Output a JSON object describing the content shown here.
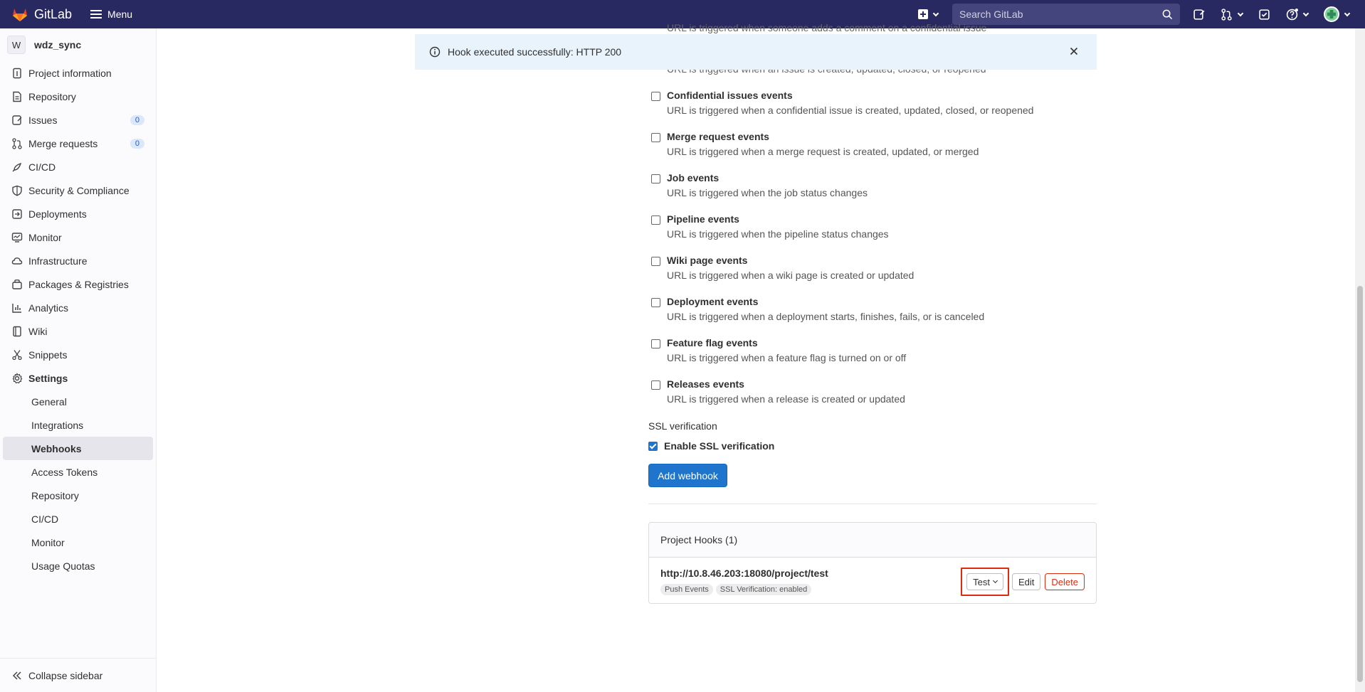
{
  "topbar": {
    "brand": "GitLab",
    "menu_label": "Menu",
    "search_placeholder": "Search GitLab"
  },
  "sidebar": {
    "project_initial": "W",
    "project_name": "wdz_sync",
    "items": [
      {
        "label": "Project information",
        "icon": "info-icon"
      },
      {
        "label": "Repository",
        "icon": "doc-icon"
      },
      {
        "label": "Issues",
        "icon": "issues-icon",
        "badge": "0"
      },
      {
        "label": "Merge requests",
        "icon": "merge-icon",
        "badge": "0"
      },
      {
        "label": "CI/CD",
        "icon": "rocket-icon"
      },
      {
        "label": "Security & Compliance",
        "icon": "shield-icon"
      },
      {
        "label": "Deployments",
        "icon": "deploy-icon"
      },
      {
        "label": "Monitor",
        "icon": "monitor-icon"
      },
      {
        "label": "Infrastructure",
        "icon": "cloud-icon"
      },
      {
        "label": "Packages & Registries",
        "icon": "package-icon"
      },
      {
        "label": "Analytics",
        "icon": "chart-icon"
      },
      {
        "label": "Wiki",
        "icon": "book-icon"
      },
      {
        "label": "Snippets",
        "icon": "scissors-icon"
      },
      {
        "label": "Settings",
        "icon": "gear-icon"
      }
    ],
    "settings_sub": [
      "General",
      "Integrations",
      "Webhooks",
      "Access Tokens",
      "Repository",
      "CI/CD",
      "Monitor",
      "Usage Quotas"
    ],
    "collapse_label": "Collapse sidebar"
  },
  "flash": {
    "message": "Hook executed successfully: HTTP 200"
  },
  "partial_lines": {
    "top1": "URL is triggered when someone adds a comment on a confidential issue",
    "top2": "URL is triggered when an issue is created, updated, closed, or reopened"
  },
  "events": [
    {
      "title": "Confidential issues events",
      "desc": "URL is triggered when a confidential issue is created, updated, closed, or reopened"
    },
    {
      "title": "Merge request events",
      "desc": "URL is triggered when a merge request is created, updated, or merged"
    },
    {
      "title": "Job events",
      "desc": "URL is triggered when the job status changes"
    },
    {
      "title": "Pipeline events",
      "desc": "URL is triggered when the pipeline status changes"
    },
    {
      "title": "Wiki page events",
      "desc": "URL is triggered when a wiki page is created or updated"
    },
    {
      "title": "Deployment events",
      "desc": "URL is triggered when a deployment starts, finishes, fails, or is canceled"
    },
    {
      "title": "Feature flag events",
      "desc": "URL is triggered when a feature flag is turned on or off"
    },
    {
      "title": "Releases events",
      "desc": "URL is triggered when a release is created or updated"
    }
  ],
  "ssl": {
    "section_label": "SSL verification",
    "checkbox_label": "Enable SSL verification",
    "checked": true
  },
  "add_button": "Add webhook",
  "hooks": {
    "header": "Project Hooks (1)",
    "url": "http://10.8.46.203:18080/project/test",
    "tags": [
      "Push Events",
      "SSL Verification: enabled"
    ],
    "test_label": "Test",
    "edit_label": "Edit",
    "delete_label": "Delete"
  },
  "colors": {
    "topbar": "#292961",
    "primary": "#1f75cb",
    "danger": "#dd2b0e"
  }
}
